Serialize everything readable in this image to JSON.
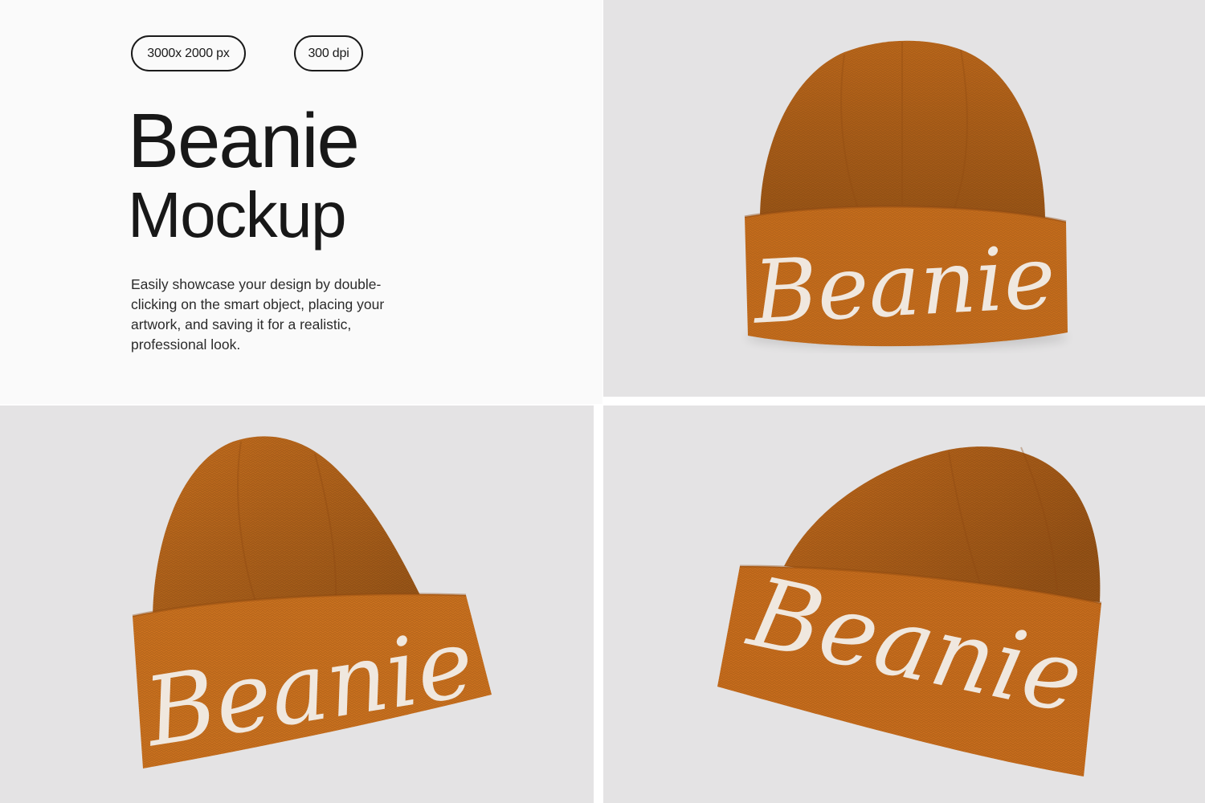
{
  "intro": {
    "badges": {
      "resolution": "3000x 2000 px",
      "dpi": "300 dpi"
    },
    "title_line1": "Beanie",
    "title_line2": "Mockup",
    "description": "Easily showcase your design by double-clicking on the smart object, placing your artwork, and saving it for a realistic, professional look."
  },
  "photos": [
    {
      "cuff_text": "Beanie"
    },
    {
      "cuff_text": "Beanie"
    },
    {
      "cuff_text": "Beanie"
    }
  ],
  "colors": {
    "intro_background": "#fafafa",
    "photo_background": "#e4e3e4",
    "beanie_orange": "#c9711f",
    "beanie_shadow": "#9b5214",
    "print_white": "#f3f1ee",
    "text_dark": "#181818"
  }
}
